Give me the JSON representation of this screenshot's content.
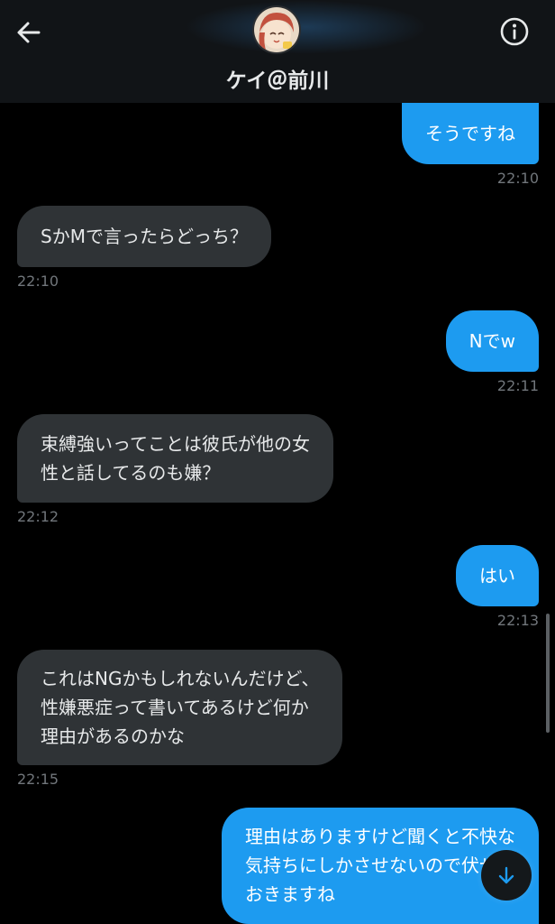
{
  "header": {
    "title": "ケイ＠前川",
    "back_icon": "arrow-left-icon",
    "info_icon": "info-circle-icon",
    "accent": "#1d9bf0"
  },
  "messages": [
    {
      "side": "out",
      "text": [
        "そうですね"
      ],
      "time": "22:10"
    },
    {
      "side": "in",
      "text": [
        "SかMで言ったらどっち？"
      ],
      "time": "22:10"
    },
    {
      "side": "out",
      "text": [
        "Nでw"
      ],
      "time": "22:11"
    },
    {
      "side": "in",
      "text": [
        "束縛強いってことは彼氏が他の女",
        "性と話してるのも嫌？"
      ],
      "time": "22:12"
    },
    {
      "side": "out",
      "text": [
        "はい"
      ],
      "time": "22:13"
    },
    {
      "side": "in",
      "text": [
        "これはNGかもしれないんだけど、",
        "性嫌悪症って書いてあるけど何か",
        "理由があるのかな"
      ],
      "time": "22:15"
    },
    {
      "side": "out",
      "text": [
        "理由はありますけど聞くと不快な",
        "気持ちにしかさせないので伏せて",
        "おきますね"
      ],
      "time": ""
    }
  ],
  "scroll_down_icon": "arrow-down-icon"
}
